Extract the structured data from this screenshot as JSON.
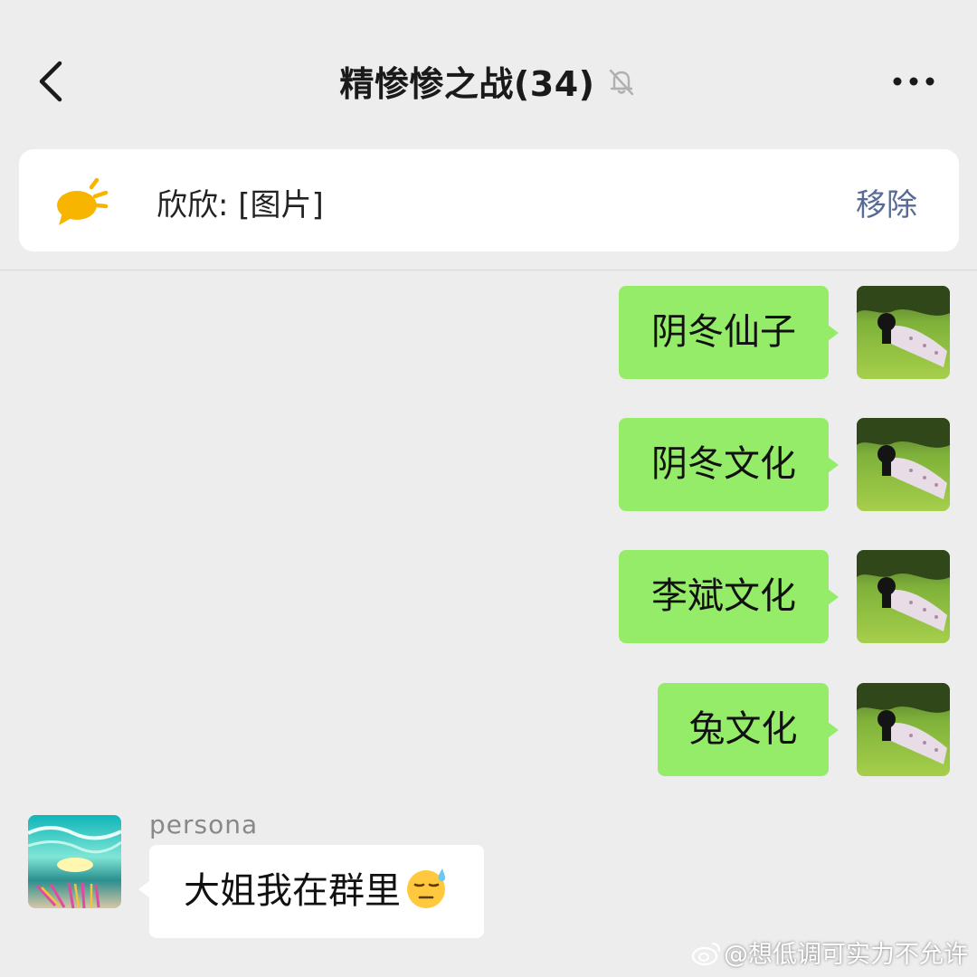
{
  "header": {
    "title": "精惨惨之战(34)",
    "back_icon": "chevron-left-icon",
    "mute_icon": "bell-slash-icon",
    "more_icon": "more-dots-icon"
  },
  "pinned": {
    "icon": "chat-bubble-sparkle-icon",
    "text": "欣欣: [图片]",
    "remove_label": "移除"
  },
  "messages": [
    {
      "side": "right",
      "text": "阴冬仙子"
    },
    {
      "side": "right",
      "text": "阴冬文化"
    },
    {
      "side": "right",
      "text": "李斌文化"
    },
    {
      "side": "right",
      "text": "兔文化"
    },
    {
      "side": "left",
      "sender": "persona",
      "text": "大姐我在群里",
      "emoji": "sweat-face-emoji"
    }
  ],
  "watermark": "@想低调可实力不允许",
  "colors": {
    "background": "#ededed",
    "self_bubble": "#95ec69",
    "other_bubble": "#ffffff",
    "link_blue": "#576b95",
    "pin_icon": "#f7b500"
  }
}
